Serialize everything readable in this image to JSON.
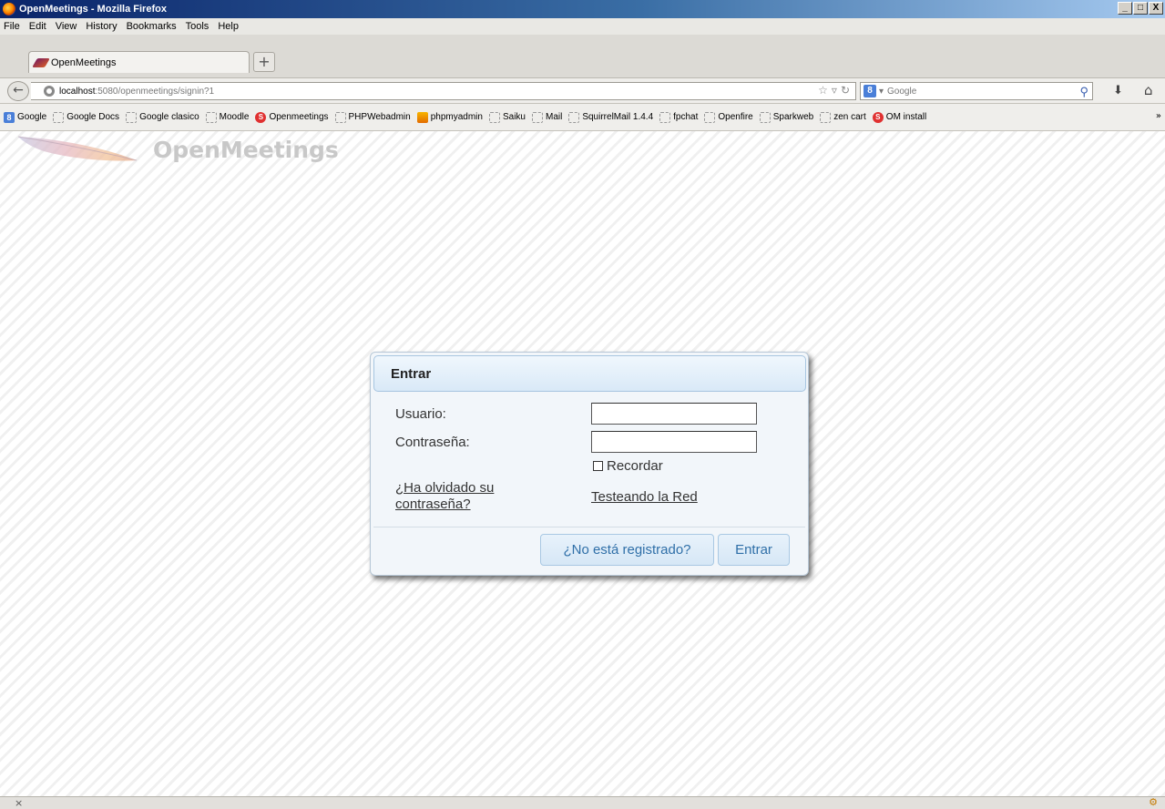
{
  "window": {
    "title": "OpenMeetings - Mozilla Firefox",
    "minimize": "_",
    "maximize": "□",
    "close": "X"
  },
  "menu": [
    "File",
    "Edit",
    "View",
    "History",
    "Bookmarks",
    "Tools",
    "Help"
  ],
  "tab": {
    "label": "OpenMeetings",
    "new_tab": "+"
  },
  "nav": {
    "url_host": "localhost",
    "url_rest": ":5080/openmeetings/signin?1",
    "search_placeholder": "Google",
    "search_engine": "8"
  },
  "bookmarks": [
    {
      "label": "Google",
      "icon": "google"
    },
    {
      "label": "Google Docs",
      "icon": "page"
    },
    {
      "label": "Google clasico",
      "icon": "page"
    },
    {
      "label": "Moodle",
      "icon": "page"
    },
    {
      "label": "Openmeetings",
      "icon": "om"
    },
    {
      "label": "PHPWebadmin",
      "icon": "page"
    },
    {
      "label": "phpmyadmin",
      "icon": "pma"
    },
    {
      "label": "Saiku",
      "icon": "page"
    },
    {
      "label": "Mail",
      "icon": "page"
    },
    {
      "label": "SquirrelMail 1.4.4",
      "icon": "page"
    },
    {
      "label": "fpchat",
      "icon": "page"
    },
    {
      "label": "Openfire",
      "icon": "page"
    },
    {
      "label": "Sparkweb",
      "icon": "page"
    },
    {
      "label": "zen cart",
      "icon": "page"
    },
    {
      "label": "OM install",
      "icon": "om"
    }
  ],
  "bookmarks_more": "»",
  "page": {
    "brand": "OpenMeetings"
  },
  "login": {
    "title": "Entrar",
    "user_label": "Usuario:",
    "password_label": "Contraseña:",
    "user_value": "",
    "password_value": "",
    "remember_label": "Recordar",
    "forgot_line1": "¿Ha olvidado su",
    "forgot_line2": "contraseña?",
    "network_test": "Testeando la Red",
    "register_button": "¿No está registrado?",
    "submit_button": "Entrar"
  },
  "status": {
    "close_glyph": "×"
  },
  "colors": {
    "dialog_header": "#d9e9f7",
    "button_text": "#2f6fa8",
    "brand_text": "#c8c8c8"
  }
}
